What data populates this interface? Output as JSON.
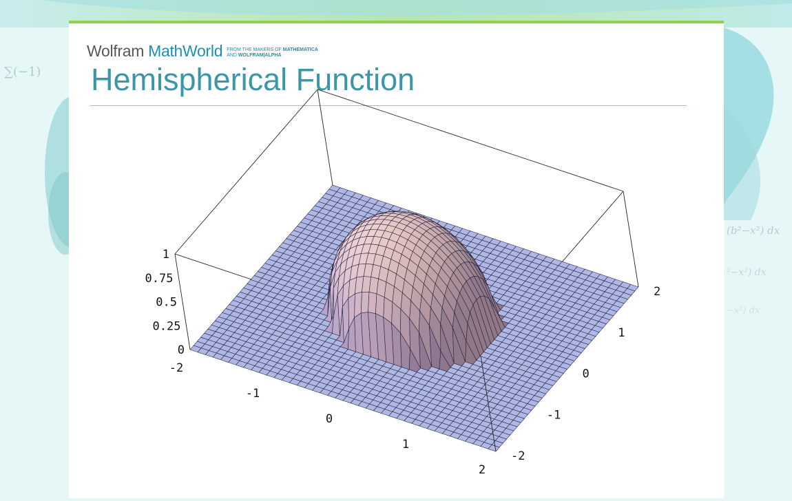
{
  "brand": {
    "wolfram": "Wolfram",
    "mathworld": "MathWorld",
    "tagline_line1_prefix": "FROM THE MAKERS OF",
    "tagline_line1_bold": "MATHEMATICA",
    "tagline_line2_prefix": "AND",
    "tagline_line2_bold": "WOLFRAM|ALPHA"
  },
  "page": {
    "title": "Hemispherical Function"
  },
  "colors": {
    "accent_green": "#8fd14f",
    "brand_blue": "#1b8fb6",
    "title_teal": "#3b97a8",
    "background": "#e6f7f7"
  },
  "chart_data": {
    "type": "surface3d",
    "function": "z = sqrt(1 - x^2 - y^2) for x^2 + y^2 <= 1, else 0",
    "x_range": [
      -2,
      2
    ],
    "y_range": [
      -2,
      2
    ],
    "z_range": [
      0,
      1
    ],
    "x_ticks": [
      "-2",
      "-1",
      "0",
      "1",
      "2"
    ],
    "y_ticks": [
      "-2",
      "-1",
      "0",
      "1",
      "2"
    ],
    "z_ticks": [
      "0",
      "0.25",
      "0.5",
      "0.75",
      "1"
    ],
    "grid_lines_per_axis": 41,
    "box": true,
    "shading": "lit mesh, blue floor, pink/orange dome"
  }
}
